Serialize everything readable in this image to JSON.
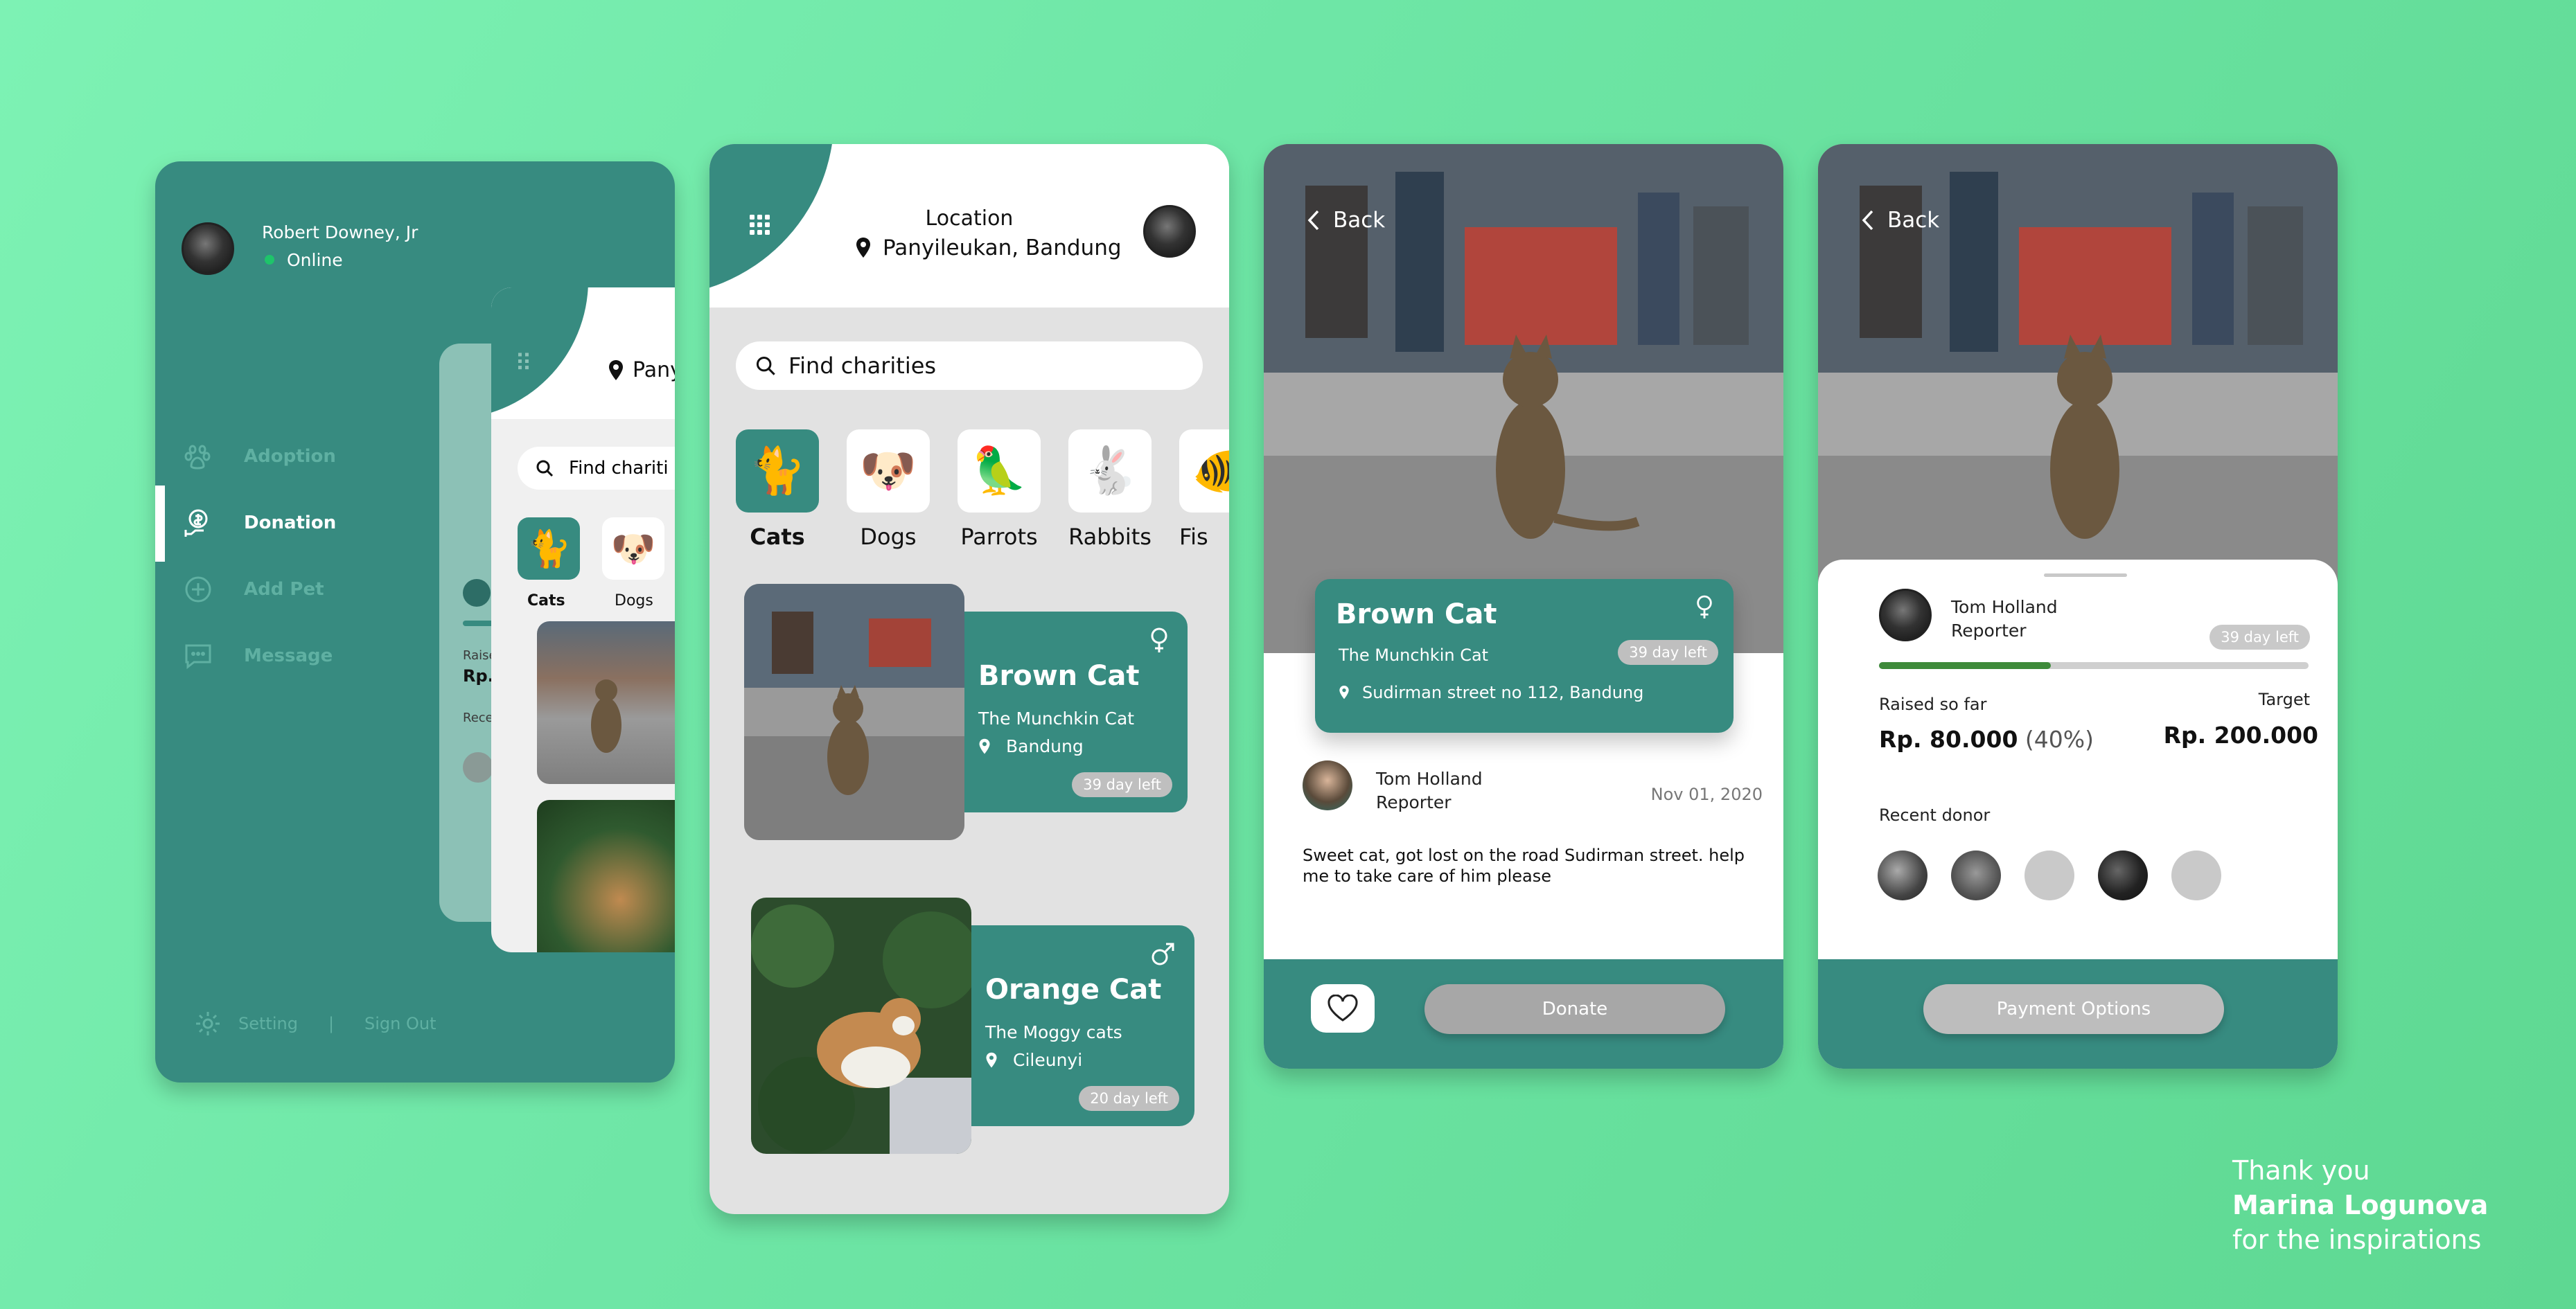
{
  "colors": {
    "teal": "#378b80",
    "background": "#6ee6a6",
    "online": "#1ec46a",
    "pill": "#bfbfbf"
  },
  "menu_screen": {
    "user_name": "Robert Downey, Jr",
    "status": "Online",
    "items": [
      {
        "label": "Adoption",
        "icon": "paw-icon"
      },
      {
        "label": "Donation",
        "icon": "donation-icon"
      },
      {
        "label": "Add Pet",
        "icon": "plus-circle-icon"
      },
      {
        "label": "Message",
        "icon": "message-icon"
      }
    ],
    "setting": "Setting",
    "separator": "|",
    "sign_out": "Sign Out",
    "peek": {
      "location": "Pany",
      "search": "Find chariti",
      "raised_fragment": "Raise",
      "rp_fragment": "Rp.",
      "recent_fragment": "Rece",
      "cats": "Cats",
      "dogs": "Dogs"
    }
  },
  "home_screen": {
    "location_label": "Location",
    "location_value": "Panyileukan, Bandung",
    "search_placeholder": "Find charities",
    "categories": [
      {
        "label": "Cats",
        "emoji": "🐈"
      },
      {
        "label": "Dogs",
        "emoji": "🐶"
      },
      {
        "label": "Parrots",
        "emoji": "🦜"
      },
      {
        "label": "Rabbits",
        "emoji": "🐇"
      },
      {
        "label": "Fis",
        "emoji": "🐠"
      }
    ],
    "pets": [
      {
        "name": "Brown Cat",
        "breed": "The Munchkin Cat",
        "location": "Bandung",
        "days_left": "39 day left",
        "gender": "female"
      },
      {
        "name": "Orange Cat",
        "breed": "The Moggy cats",
        "location": "Cileunyi",
        "days_left": "20 day left",
        "gender": "male"
      }
    ]
  },
  "detail_screen": {
    "back": "Back",
    "pet_name": "Brown Cat",
    "breed": "The Munchkin Cat",
    "days_left": "39 day left",
    "address": "Sudirman street no 112, Bandung",
    "reporter_name": "Tom Holland",
    "reporter_role": "Reporter",
    "date": "Nov 01, 2020",
    "description": "Sweet cat, got lost on the road Sudirman street. help me to take care of him please",
    "donate": "Donate"
  },
  "donation_screen": {
    "back": "Back",
    "reporter_name": "Tom Holland",
    "reporter_role": "Reporter",
    "days_left": "39 day left",
    "progress": 0.4,
    "raised_label": "Raised so far",
    "raised_value": "Rp. 80.000",
    "raised_percent": "(40%)",
    "target_label": "Target",
    "target_value": "Rp. 200.000",
    "recent_donor_label": "Recent donor",
    "payment_options": "Payment Options"
  },
  "credits": {
    "line1": "Thank you",
    "line2": "Marina Logunova",
    "line3": "for the inspirations"
  }
}
